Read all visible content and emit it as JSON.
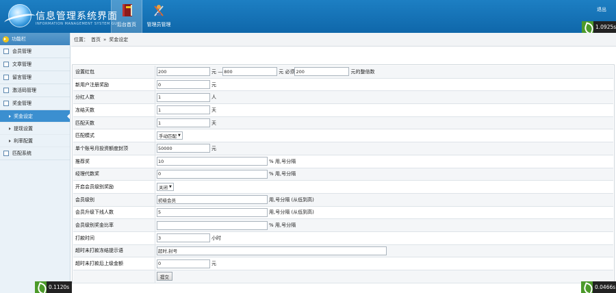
{
  "header": {
    "title": "信息管理系统界面",
    "subtitle": "INFORMATION MANAGEMENT SYSTEM GUI",
    "nav": [
      {
        "label": "后台首页",
        "icon": "book-icon",
        "active": true
      },
      {
        "label": "管理员管理",
        "icon": "tools-icon",
        "active": false
      }
    ],
    "logout": "退出",
    "timer": "1.0925s"
  },
  "sidebar": {
    "head": "功能栏",
    "items": [
      {
        "label": "会员管理"
      },
      {
        "label": "文章管理"
      },
      {
        "label": "留言管理"
      },
      {
        "label": "激活码管理"
      },
      {
        "label": "奖金管理"
      }
    ],
    "subitems": [
      {
        "label": "奖金设定",
        "active": true
      },
      {
        "label": "提现设置",
        "active": false
      },
      {
        "label": "利率配置",
        "active": false
      }
    ],
    "last_item": "匹配系统",
    "timer": "0.1120s"
  },
  "breadcrumb": {
    "prefix": "位置：",
    "home": "首页",
    "sep": "»",
    "current": "奖金设定"
  },
  "form": {
    "rows": [
      {
        "label": "设置红包",
        "v1": "200",
        "u1": "元 —",
        "v2": "800",
        "u2": "元 必须",
        "v3": "200",
        "u3": "元的整倍数"
      },
      {
        "label": "新用户注册奖励",
        "value": "0",
        "unit": "元"
      },
      {
        "label": "分红人数",
        "value": "1",
        "unit": "人"
      },
      {
        "label": "冻结天数",
        "value": "1",
        "unit": "天"
      },
      {
        "label": "匹配天数",
        "value": "1",
        "unit": "天"
      },
      {
        "label": "匹配模式",
        "select": "手动匹配"
      },
      {
        "label": "单个账号月投资额度封顶",
        "value": "50000",
        "unit": "元"
      },
      {
        "label": "推荐奖",
        "value": "10",
        "unit": "% 用,号分隔"
      },
      {
        "label": "经理代数奖",
        "value": "0",
        "unit": "% 用,号分隔"
      },
      {
        "label": "开启会员级别奖励",
        "select": "关闭"
      },
      {
        "label": "会员级别",
        "value": "初级会员",
        "unit": "用,号分隔 (从低到高)"
      },
      {
        "label": "会员升级下线人数",
        "value": "5",
        "unit": "用,号分隔 (从低到高)"
      },
      {
        "label": "会员级别奖金比率",
        "value": "",
        "unit": "% 用,号分隔"
      },
      {
        "label": "打款时间",
        "value": "3",
        "unit": "小时"
      },
      {
        "label": "超时未打款冻结提示语",
        "value": "超时,封号",
        "unit": ""
      },
      {
        "label": "超时未打款后上级金额",
        "value": "0",
        "unit": "元"
      }
    ],
    "submit": "提交"
  },
  "footer_timer": "0.0466s"
}
